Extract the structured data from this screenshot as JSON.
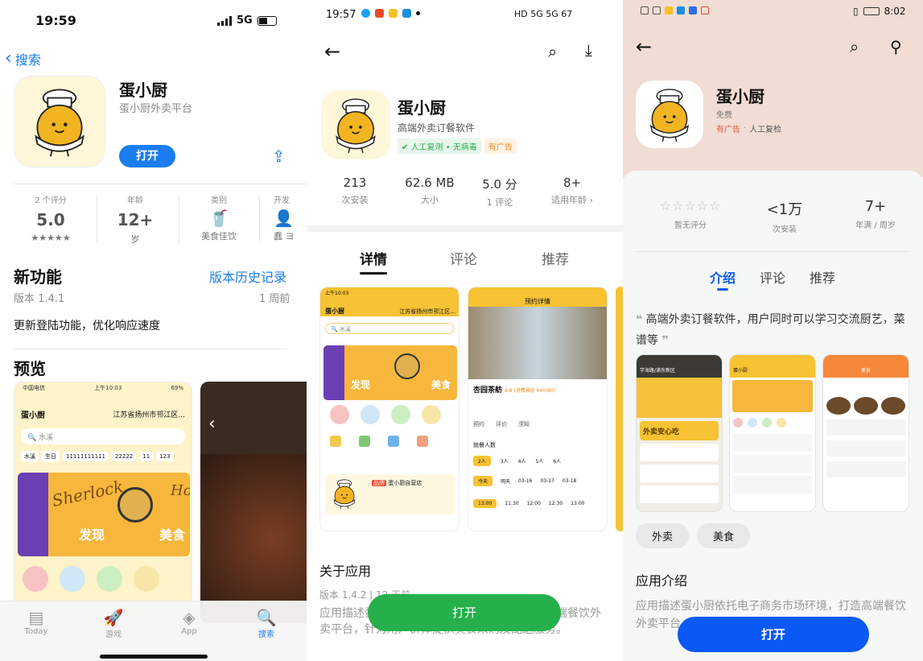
{
  "ios": {
    "status_time": "19:59",
    "status_net": "5G",
    "back_label": "搜索",
    "app_name": "蛋小厨",
    "app_subtitle": "蛋小厨外卖平台",
    "open_label": "打开",
    "stats": [
      {
        "top": "2 个评分",
        "main": "5.0",
        "bottom": "★★★★★"
      },
      {
        "top": "年龄",
        "main": "12+",
        "bottom": "岁"
      },
      {
        "top": "类别",
        "main": "",
        "bottom": "美食佳饮"
      },
      {
        "top": "开发",
        "main": "",
        "bottom": "蠢 ヨ"
      }
    ],
    "whats_new_title": "新功能",
    "version_history": "版本历史记录",
    "version": "版本 1.4.1",
    "version_time": "1 周前",
    "update_note": "更新登陆功能，优化响应速度",
    "preview_title": "预览",
    "preview": {
      "carrier": "中国电信",
      "time": "上午10:03",
      "battery": "69%",
      "app": "蛋小厨",
      "location": "江苏省扬州市邗江区...",
      "search": "水溪",
      "tags": [
        "水溪",
        "生日",
        "11111111111",
        "22222",
        "11",
        "123"
      ],
      "banner1": "Sherlock",
      "banner_l": "发现",
      "banner_r": "美食",
      "banner_h": "Hol"
    },
    "tabs": [
      {
        "label": "Today"
      },
      {
        "label": "游戏"
      },
      {
        "label": "App"
      },
      {
        "label": "搜索"
      }
    ]
  },
  "oppo": {
    "status_time": "19:57",
    "status_right": "HD 5G 5G 67",
    "app_name": "蛋小厨",
    "app_subtitle": "高端外卖订餐软件",
    "safe_badge": "人工复测 • 无病毒",
    "ad_badge": "有广告",
    "stats": [
      {
        "main": "213",
        "sub": "次安装"
      },
      {
        "main": "62.6 MB",
        "sub": "大小"
      },
      {
        "main": "5.0 分",
        "sub": "1 评论"
      },
      {
        "main": "8+",
        "sub": "适用年龄 ›"
      }
    ],
    "tabs": [
      "详情",
      "评论",
      "推荐"
    ],
    "about_title": "关于应用",
    "about_version": "版本 1.4.2 | 12 天前",
    "about_text": "应用描述蛋小厨依托电子商务市场环境，打造高端餐饮外卖平台，针对用户群体提供美食采购及配送服务。",
    "open_label": "打开",
    "shot1": {
      "time": "上午10:03",
      "app": "蛋小厨",
      "location": "江苏省扬州市邗江区...",
      "search": "水溪",
      "banner_l": "发现",
      "banner_r": "美食",
      "store": "蛋小厨自营店",
      "store_tag": "品牌"
    },
    "shot2": {
      "title": "预约详情",
      "venue": "杏园茶舫",
      "badge": "4.8 (消费满返 ¥40/80)",
      "tabs": [
        "预约",
        "评价",
        "须知"
      ],
      "label": "就餐人数",
      "people": [
        "2人",
        "3人",
        "4人",
        "5人",
        "6人"
      ],
      "dates": [
        "今天",
        "明天",
        "03-16",
        "03-17",
        "03-18"
      ],
      "times": [
        "13:00",
        "11:30",
        "12:00",
        "12:30",
        "13:00"
      ]
    }
  },
  "huawei": {
    "status_time": "8:02",
    "app_name": "蛋小厨",
    "app_price": "免费",
    "ad_label": "有广告",
    "review_label": "人工复检",
    "stats": [
      {
        "main": "☆☆☆☆☆",
        "sub": "暂无评分"
      },
      {
        "main": "<1万",
        "sub": "次安装"
      },
      {
        "main": "7+",
        "sub": "年满 / 周岁"
      }
    ],
    "tabs": [
      "介绍",
      "评论",
      "推荐"
    ],
    "quote": "高端外卖订餐软件，用户同时可以学习交流厨艺，菜谱等",
    "chips": [
      "外卖",
      "美食"
    ],
    "about_title": "应用介绍",
    "about_text": "应用描述蛋小厨依托电子商务市场环境，打造高端餐饮外卖平台，",
    "open_label": "打开",
    "shot1": {
      "location": "学海路/浦东新区",
      "banner": "外卖安心吃"
    },
    "shot2": {
      "title": "蛋小厨"
    },
    "shot3": {
      "title": "美食"
    }
  },
  "colors": {
    "ios_blue": "#1a7ef0",
    "green": "#26b04b",
    "huawei_blue": "#0a59f7",
    "yellow": "#f7c233"
  }
}
